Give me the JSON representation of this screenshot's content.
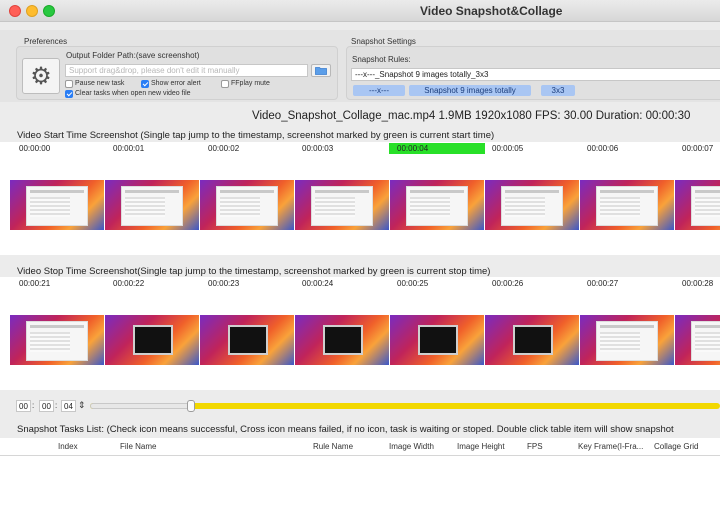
{
  "window": {
    "title": "Video Snapshot&Collage"
  },
  "preferences": {
    "section_label": "Preferences",
    "folder_label": "Output Folder Path:(save screenshot)",
    "folder_placeholder": "Support drag&drop, please don't edit it manually",
    "checkboxes": [
      {
        "label": "Pause new task",
        "checked": false
      },
      {
        "label": "Show error alert",
        "checked": true
      },
      {
        "label": "FFplay mute",
        "checked": false
      },
      {
        "label": "Clear tasks when open new video file",
        "checked": true
      }
    ]
  },
  "snapshot_settings": {
    "section_label": "Snapshot Settings",
    "rules_label": "Snapshot Rules:",
    "rule_value": "---x---_Snapshot 9 images totally_3x3",
    "chips": [
      "---x---",
      "Snapshot 9 images totally",
      "3x3"
    ]
  },
  "file_info": {
    "text": "Video_Snapshot_Collage_mac.mp4   1.9MB   1920x1080   FPS: 30.00   Duration: 00:00:30"
  },
  "start_section": {
    "header": "Video Start Time Screenshot (Single tap jump to the timestamp, screenshot marked by green is current start time)",
    "timestamps": [
      "00:00:00",
      "00:00:01",
      "00:00:02",
      "00:00:03",
      "00:00:04",
      "00:00:05",
      "00:00:06",
      "00:00:07"
    ],
    "selected_index": 4
  },
  "stop_section": {
    "header": "Video Stop Time Screenshot(Single tap jump to the timestamp, screenshot marked by green is current stop time)",
    "timestamps": [
      "00:00:21",
      "00:00:22",
      "00:00:23",
      "00:00:24",
      "00:00:25",
      "00:00:26",
      "00:00:27",
      "00:00:28"
    ]
  },
  "time_input": {
    "hh": "00",
    "mm": "00",
    "ss": "04",
    "progress_fraction": 0.16
  },
  "tasks_list": {
    "header": "Snapshot Tasks List: (Check icon means successful,  Cross icon means failed,  if no icon,  task is waiting or stoped. Double click table item will show snapshot",
    "columns": [
      "Index",
      "File Name",
      "Rule Name",
      "Image Width",
      "Image Height",
      "FPS",
      "Key Frame(I-Fra...",
      "Collage Grid"
    ]
  },
  "colors": {
    "selected_green": "#28e028",
    "slider_yellow": "#f2d800",
    "chip_blue": "#a9c6f3"
  },
  "icons": [
    "gear-icon",
    "folder-icon"
  ]
}
